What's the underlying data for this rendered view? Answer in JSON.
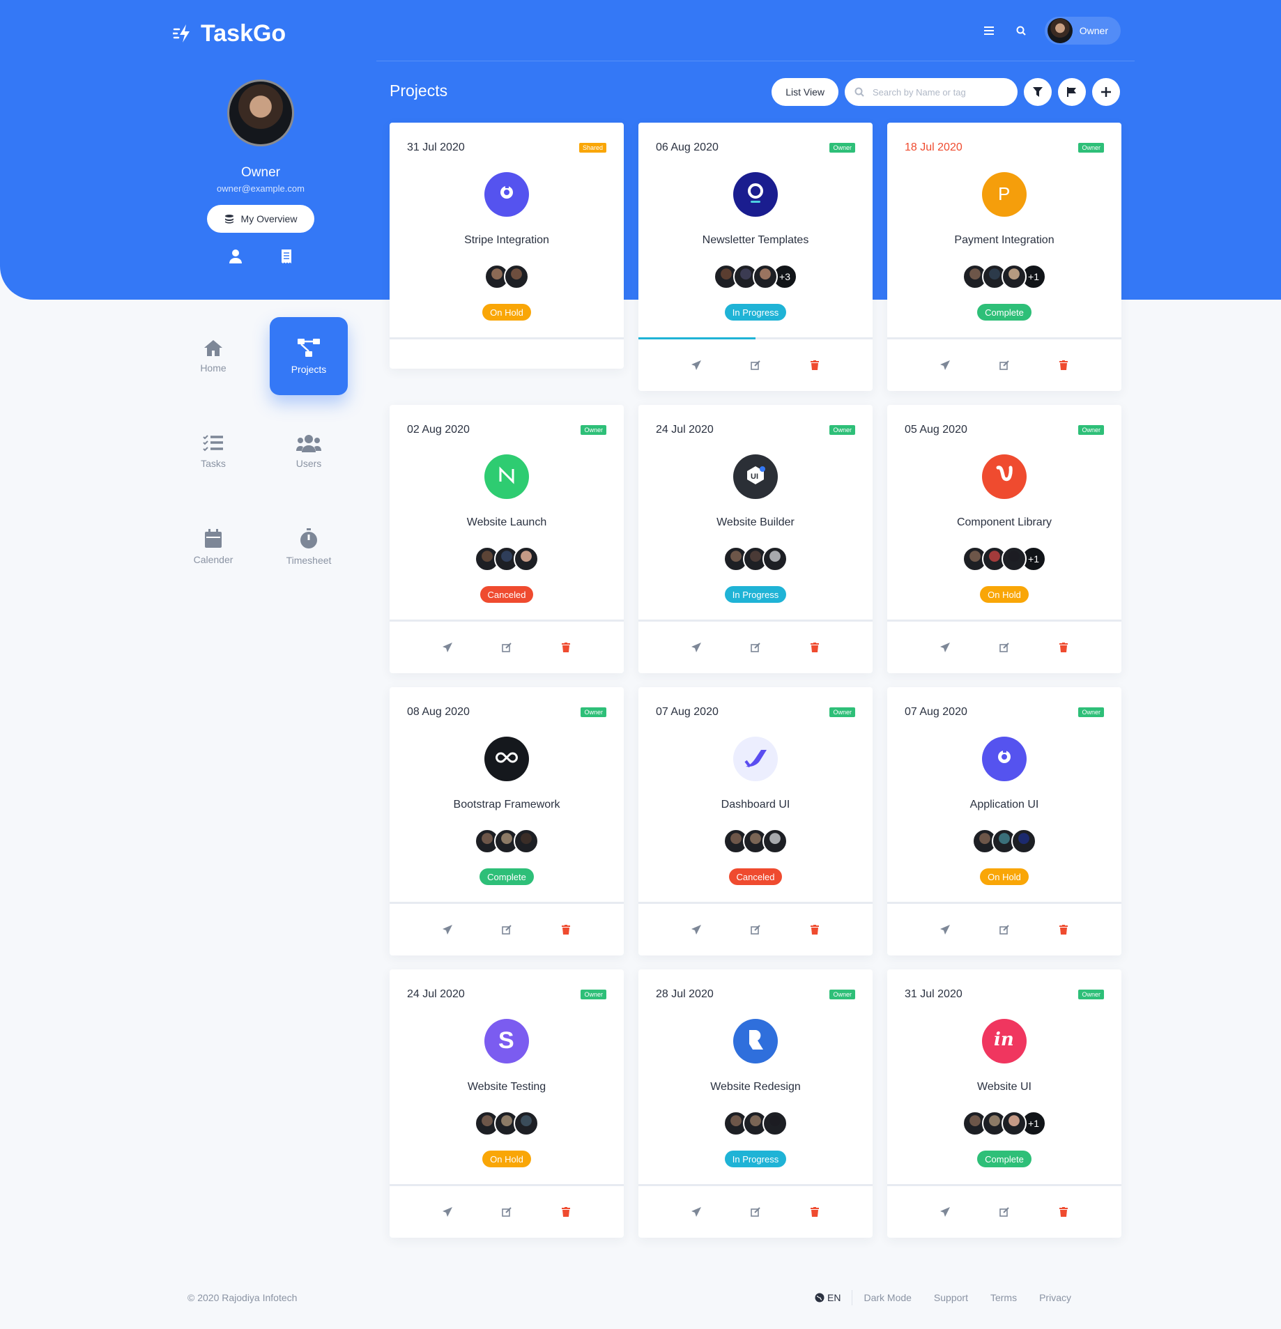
{
  "app": {
    "name": "TaskGo",
    "user_label": "Owner"
  },
  "profile": {
    "name": "Owner",
    "email": "owner@example.com",
    "overview_label": "My Overview"
  },
  "nav": [
    {
      "label": "Home",
      "icon": "home-icon"
    },
    {
      "label": "Projects",
      "icon": "sitemap-icon",
      "active": true
    },
    {
      "label": "Tasks",
      "icon": "list-check-icon"
    },
    {
      "label": "Users",
      "icon": "users-icon"
    },
    {
      "label": "Calender",
      "icon": "calendar-icon"
    },
    {
      "label": "Timesheet",
      "icon": "stopwatch-icon"
    }
  ],
  "page": {
    "title": "Projects",
    "list_view_label": "List View",
    "search_placeholder": "Search by Name or tag"
  },
  "colors": {
    "primary": "#3478f6",
    "on_hold": "#f9a607",
    "in_progress": "#1fb3d6",
    "complete": "#2ebf78",
    "canceled": "#ef4b2f",
    "shared_tag": "#f9a607",
    "owner_tag": "#2ebf78"
  },
  "projects": [
    {
      "date": "31 Jul 2020",
      "tag": "Shared",
      "name": "Stripe Integration",
      "status": "On Hold",
      "logo": "stripe-logo",
      "logo_bg": "#5553ef",
      "team": [
        "#8b6a55",
        "#6e4e3e"
      ],
      "extra": "",
      "progress": 0,
      "late": false,
      "actions": false
    },
    {
      "date": "06 Aug 2020",
      "tag": "Owner",
      "name": "Newsletter Templates",
      "status": "In Progress",
      "logo": "newsletter-logo",
      "logo_bg": "#1a1d8f",
      "team": [
        "#5a3d30",
        "#3b3b52",
        "#9a7460"
      ],
      "extra": "+3",
      "progress": 50,
      "late": false,
      "actions": true
    },
    {
      "date": "18 Jul 2020",
      "tag": "Owner",
      "name": "Payment Integration",
      "status": "Complete",
      "logo": "p-letter-logo",
      "logo_bg": "#f59e0b",
      "team": [
        "#6d5649",
        "#2c3a4a",
        "#b59a80"
      ],
      "extra": "+1",
      "progress": 0,
      "late": true,
      "actions": true
    },
    {
      "date": "02 Aug 2020",
      "tag": "Owner",
      "name": "Website Launch",
      "status": "Canceled",
      "logo": "n-logo",
      "logo_bg": "#2ecc71",
      "team": [
        "#5c4436",
        "#2f3e5a",
        "#c59a86"
      ],
      "extra": "",
      "progress": 0,
      "late": false,
      "actions": true
    },
    {
      "date": "24 Jul 2020",
      "tag": "Owner",
      "name": "Website Builder",
      "status": "In Progress",
      "logo": "ui8-logo",
      "logo_bg": "#2b2f36",
      "team": [
        "#6d5649",
        "#4a3a36",
        "#a7a9ad"
      ],
      "extra": "",
      "progress": 0,
      "late": false,
      "actions": true
    },
    {
      "date": "05 Aug 2020",
      "tag": "Owner",
      "name": "Component Library",
      "status": "On Hold",
      "logo": "shield-u-logo",
      "logo_bg": "#ef4b2f",
      "team": [
        "#6d5649",
        "#a33b3b",
        "#1c1c22"
      ],
      "extra": "+1",
      "progress": 0,
      "late": false,
      "actions": true
    },
    {
      "date": "08 Aug 2020",
      "tag": "Owner",
      "name": "Bootstrap Framework",
      "status": "Complete",
      "logo": "infinity-logo",
      "logo_bg": "#15181d",
      "team": [
        "#6d5649",
        "#8c7a66",
        "#3a2d27"
      ],
      "extra": "",
      "progress": 0,
      "late": false,
      "actions": true
    },
    {
      "date": "07 Aug 2020",
      "tag": "Owner",
      "name": "Dashboard UI",
      "status": "Canceled",
      "logo": "check-swoosh-logo",
      "logo_bg": "#eceefe",
      "team": [
        "#6d5649",
        "#7a6555",
        "#a7a9ad"
      ],
      "extra": "",
      "progress": 0,
      "late": false,
      "actions": true
    },
    {
      "date": "07 Aug 2020",
      "tag": "Owner",
      "name": "Application UI",
      "status": "On Hold",
      "logo": "stripe-logo",
      "logo_bg": "#5553ef",
      "team": [
        "#6d5649",
        "#3a6f7a",
        "#1c2a6e"
      ],
      "extra": "",
      "progress": 0,
      "late": false,
      "actions": true
    },
    {
      "date": "24 Jul 2020",
      "tag": "Owner",
      "name": "Website Testing",
      "status": "On Hold",
      "logo": "s-logo",
      "logo_bg": "#7b5cf0",
      "team": [
        "#6d5649",
        "#8c7a66",
        "#3a4c5a"
      ],
      "extra": "",
      "progress": 0,
      "late": false,
      "actions": true
    },
    {
      "date": "28 Jul 2020",
      "tag": "Owner",
      "name": "Website Redesign",
      "status": "In Progress",
      "logo": "r-logo",
      "logo_bg": "#2f6fdc",
      "team": [
        "#6d5649",
        "#7a6555",
        "#1c1c22"
      ],
      "extra": "",
      "progress": 0,
      "late": false,
      "actions": true
    },
    {
      "date": "31 Jul 2020",
      "tag": "Owner",
      "name": "Website UI",
      "status": "Complete",
      "logo": "invision-logo",
      "logo_bg": "#f0365f",
      "team": [
        "#6d5649",
        "#8c7a66",
        "#c59a86"
      ],
      "extra": "+1",
      "progress": 0,
      "late": false,
      "actions": true
    }
  ],
  "footer": {
    "copyright": "© 2020 Rajodiya Infotech",
    "lang": "EN",
    "links": [
      "Dark Mode",
      "Support",
      "Terms",
      "Privacy"
    ]
  }
}
